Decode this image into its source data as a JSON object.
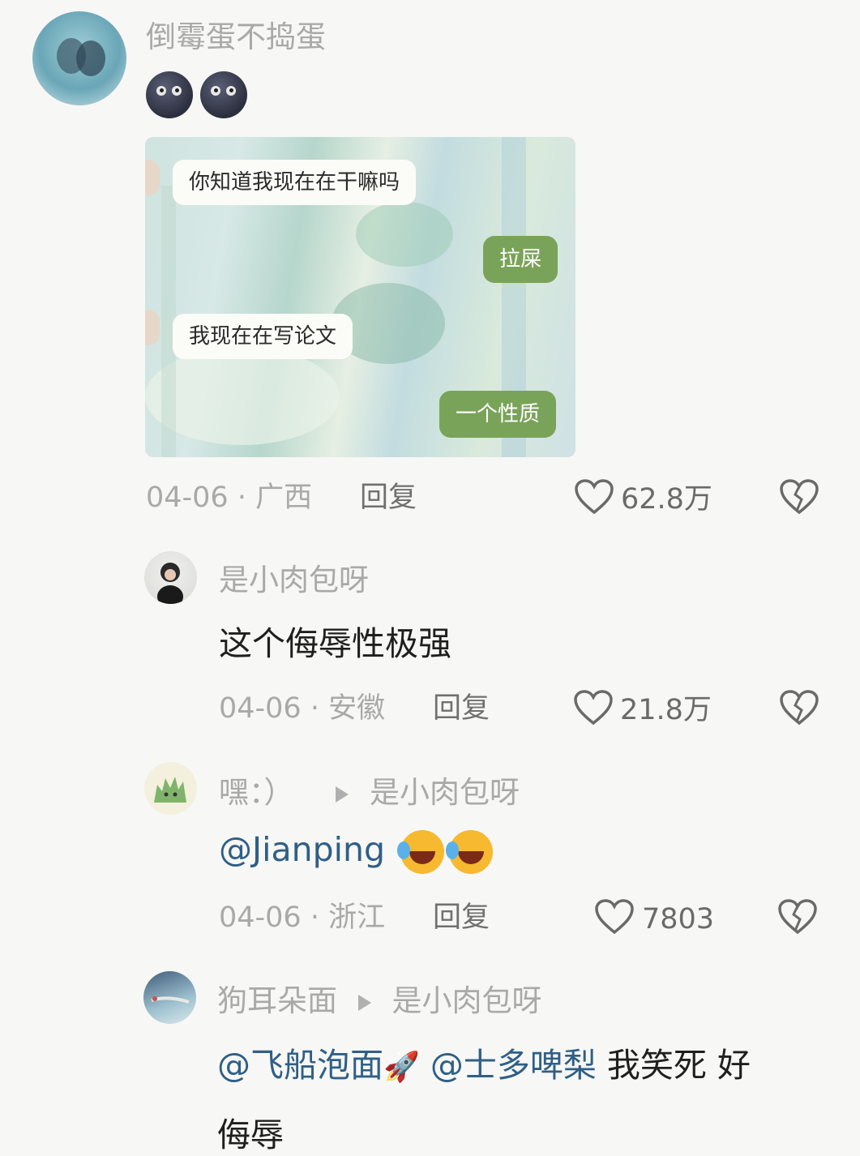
{
  "comments": [
    {
      "author": "倒霉蛋不捣蛋",
      "image": {
        "messages": [
          {
            "side": "left",
            "text": "你知道我现在在干嘛吗"
          },
          {
            "side": "right",
            "text": "拉屎"
          },
          {
            "side": "left",
            "text": "我现在在写论文"
          },
          {
            "side": "right",
            "text": "一个性质"
          }
        ]
      },
      "emojis": [
        "new-moon-face",
        "new-moon-face"
      ],
      "date": "04-06",
      "location": "广西",
      "reply_label": "回复",
      "likes": "62.8万"
    },
    {
      "author": "是小肉包呀",
      "text": "这个侮辱性极强",
      "date": "04-06",
      "location": "安徽",
      "reply_label": "回复",
      "likes": "21.8万"
    },
    {
      "author": "嘿：）",
      "reply_to": "是小肉包呀",
      "mention": "@Jianping",
      "emojis": [
        "laughing-crying",
        "laughing-crying"
      ],
      "date": "04-06",
      "location": "浙江",
      "reply_label": "回复",
      "likes": "7803"
    },
    {
      "author": "狗耳朵面",
      "reply_to": "是小肉包呀",
      "mention1": "@飞船泡面",
      "mention2": "@士多啤梨",
      "text_tail": "我笑死 好",
      "text_line2": "侮辱"
    }
  ],
  "separator": "·",
  "icons": {
    "like": "heart-outline-icon",
    "dislike": "broken-heart-icon",
    "reply_arrow": "triangle-right-icon"
  },
  "colors": {
    "name": "#a9a9a9",
    "mention": "#2f5f86",
    "bubble_right": "#7aa35a",
    "background": "#f7f7f5"
  }
}
